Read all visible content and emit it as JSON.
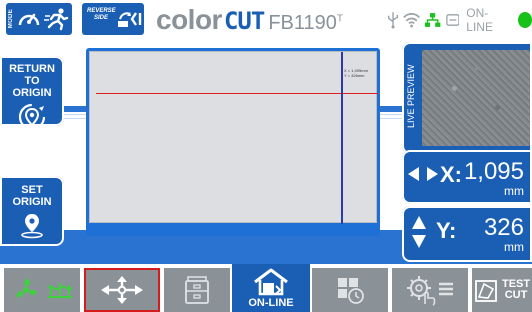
{
  "header": {
    "mode_label": "MODE",
    "reverse_label": "REVERSE SIDE",
    "logo_color": "color",
    "logo_cut": "CUT",
    "model": "FB1190",
    "model_sup": "T",
    "status_text": "ON-LINE",
    "status_color": "#19c219"
  },
  "left_panel": {
    "return_origin_label": "RETURN TO ORIGIN",
    "set_origin_label": "SET ORIGIN"
  },
  "canvas": {
    "coord_label": "X = 1,095mm\nY = 326mm",
    "line_color": "#e02020"
  },
  "preview": {
    "label": "LIVE PREVIEW"
  },
  "readout": {
    "x_axis": "X:",
    "x_value": "1,095",
    "x_unit": "mm",
    "y_axis": "Y:",
    "y_value": "326",
    "y_unit": "mm"
  },
  "toolbar": {
    "online_label": "ON-LINE",
    "test_cut_label": "TEST CUT"
  },
  "colors": {
    "accent": "#1a5fb4",
    "toolbar_grey": "#8a9197",
    "selected_outline": "#d41c1c"
  }
}
